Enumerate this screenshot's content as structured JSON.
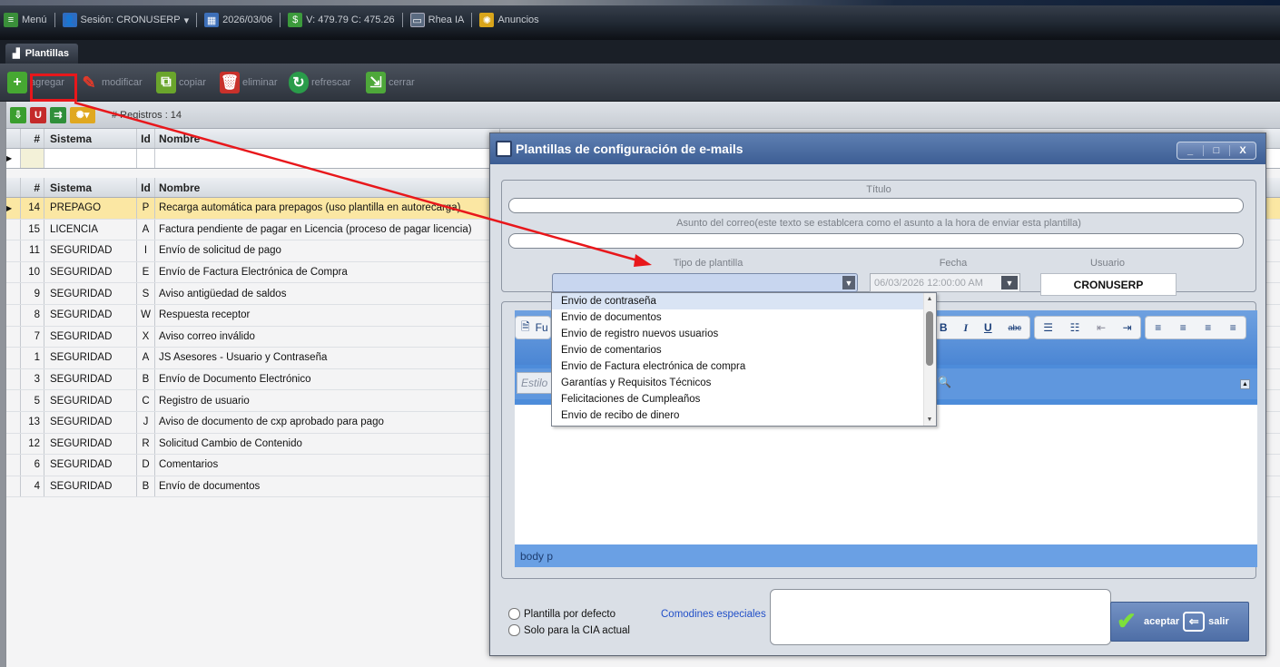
{
  "topbar": {
    "menu_label": "Menú",
    "session_label": "Sesión: CRONUSERP",
    "date": "2026/03/06",
    "rates": "V: 479.79 C: 475.26",
    "ai_label": "Rhea IA",
    "ads_label": "Anuncios"
  },
  "tab": {
    "label": "Plantillas"
  },
  "toolbar": {
    "add": "agregar",
    "modify": "modificar",
    "copy": "copiar",
    "delete": "eliminar",
    "refresh": "refrescar",
    "close": "cerrar"
  },
  "grid": {
    "records_label": "# Registros : 14",
    "columns": {
      "num": "#",
      "system": "Sistema",
      "id": "Id",
      "name": "Nombre"
    },
    "rows": [
      {
        "num": "14",
        "system": "PREPAGO",
        "id": "P",
        "name": "Recarga automática para prepagos (uso plantilla en autorecarga)"
      },
      {
        "num": "15",
        "system": "LICENCIA",
        "id": "A",
        "name": "Factura pendiente de pagar en Licencia (proceso de pagar licencia)"
      },
      {
        "num": "11",
        "system": "SEGURIDAD",
        "id": "I",
        "name": "Envío de solicitud de pago"
      },
      {
        "num": "10",
        "system": "SEGURIDAD",
        "id": "E",
        "name": "Envío de Factura Electrónica de Compra"
      },
      {
        "num": "9",
        "system": "SEGURIDAD",
        "id": "S",
        "name": "Aviso antigüedad de saldos"
      },
      {
        "num": "8",
        "system": "SEGURIDAD",
        "id": "W",
        "name": "Respuesta receptor"
      },
      {
        "num": "7",
        "system": "SEGURIDAD",
        "id": "X",
        "name": "Aviso correo inválido"
      },
      {
        "num": "1",
        "system": "SEGURIDAD",
        "id": "A",
        "name": "JS Asesores - Usuario y Contraseña"
      },
      {
        "num": "3",
        "system": "SEGURIDAD",
        "id": "B",
        "name": "Envío de Documento Electrónico"
      },
      {
        "num": "5",
        "system": "SEGURIDAD",
        "id": "C",
        "name": "Registro de usuario"
      },
      {
        "num": "13",
        "system": "SEGURIDAD",
        "id": "J",
        "name": "Aviso de documento de cxp aprobado para pago"
      },
      {
        "num": "12",
        "system": "SEGURIDAD",
        "id": "R",
        "name": "Solicitud Cambio de Contenido"
      },
      {
        "num": "6",
        "system": "SEGURIDAD",
        "id": "D",
        "name": "Comentarios"
      },
      {
        "num": "4",
        "system": "SEGURIDAD",
        "id": "B",
        "name": "Envío de documentos"
      }
    ]
  },
  "dialog": {
    "title": "Plantillas de configuración de e-mails",
    "controls": {
      "min": "_",
      "max": "□",
      "close": "X"
    },
    "title_label": "Título",
    "subject_label": "Asunto del correo(este texto se establcera como el asunto a la hora de enviar esta plantilla)",
    "type_label": "Tipo de plantilla",
    "date_label": "Fecha",
    "user_label": "Usuario",
    "date_value": "06/03/2026 12:00:00 AM",
    "user_value": "CRONUSERP",
    "dropdown_options": [
      "Envio de contraseña",
      "Envio de documentos",
      "Envio de registro nuevos usuarios",
      "Envio de comentarios",
      "Envio de Factura electrónica de compra",
      "Garantías y Requisitos Técnicos",
      "Felicitaciones de Cumpleaños",
      "Envio de recibo de dinero"
    ],
    "editor": {
      "font_label": "Fu",
      "style_placeholder": "Estilo",
      "status_path": "body  p"
    },
    "default_template": "Plantilla por defecto",
    "cia_only": "Solo para la CIA actual",
    "special_wildcards": "Comodines especiales",
    "accept": "aceptar",
    "exit": "salir"
  },
  "colors": {
    "accent": "#3d5e94",
    "selected_row": "#fbe7a3",
    "highlight": "#e8171b"
  }
}
